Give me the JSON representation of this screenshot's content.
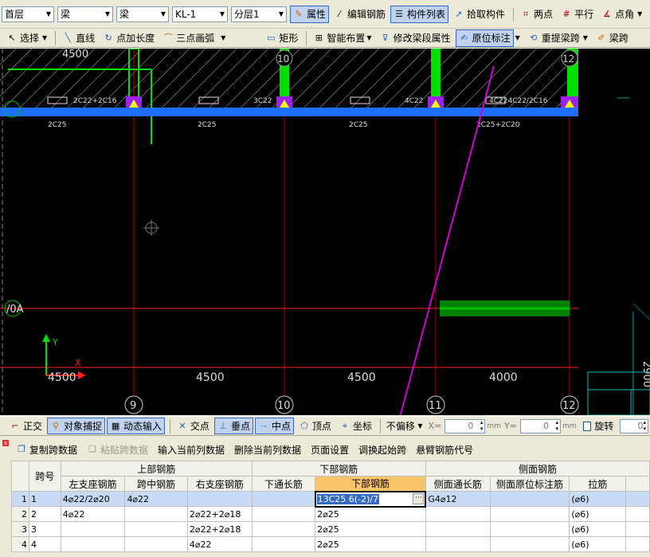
{
  "toolbar1": {
    "floor": "首层",
    "type1": "梁",
    "type2": "梁",
    "component": "KL-1",
    "layer": "分层1",
    "btn_property": "属性",
    "btn_edit_rebar": "编辑钢筋",
    "btn_component_list": "构件列表",
    "btn_pick": "拾取构件",
    "btn_two_points": "两点",
    "btn_parallel": "平行",
    "btn_point_angle": "点角"
  },
  "toolbar2": {
    "select": "选择",
    "line": "直线",
    "point_length": "点加长度",
    "three_point_arc": "三点画弧",
    "rect": "矩形",
    "smart_layout": "智能布置",
    "modify_span": "修改梁段属性",
    "in_place": "原位标注",
    "re_extract": "重提梁跨",
    "beam_span": "梁跨"
  },
  "canvas": {
    "top_dims": [
      "4500"
    ],
    "top_rebar": [
      "2C22+2C16",
      "3C22",
      "4C22",
      "4C224C22/2C16"
    ],
    "under_beam": [
      "2C25",
      "2C25",
      "2C25",
      "2C25+2C20"
    ],
    "axis_labels": [
      "9",
      "10",
      "11",
      "12"
    ],
    "axis_0A": "/0A",
    "bottom_dims": [
      "4500",
      "4500",
      "4500",
      "4000"
    ],
    "right_dim": "2900",
    "coord_y": "Y",
    "coord_x": "X"
  },
  "snapbar": {
    "ortho": "正交",
    "snap": "对象捕捉",
    "dynamic": "动态输入",
    "intersect": "交点",
    "perp": "垂点",
    "mid": "中点",
    "vertex": "顶点",
    "coord": "坐标",
    "offset": "不偏移",
    "x_label": "X=",
    "x_value": "0",
    "y_label": "Y=",
    "y_value": "0",
    "unit": "mm",
    "rotate": "旋转",
    "rotate_value": "0."
  },
  "tablebar": {
    "copy": "复制跨数据",
    "paste": "粘贴跨数据",
    "input_col": "输入当前列数据",
    "delete_col": "删除当前列数据",
    "page_setup": "页面设置",
    "swap_start": "调换起始跨",
    "cantilever": "悬臂钢筋代号"
  },
  "table": {
    "header_groups": {
      "span_no": "跨号",
      "top": "上部钢筋",
      "bottom": "下部钢筋",
      "side": "侧面钢筋"
    },
    "columns": [
      "左支座钢筋",
      "跨中钢筋",
      "右支座钢筋",
      "下通长筋",
      "下部钢筋",
      "侧面通长筋",
      "侧面原位标注筋",
      "拉筋"
    ],
    "rows": [
      {
        "n": "1",
        "span": "1",
        "cells": [
          "4⌀22/2⌀20",
          "4⌀22",
          "",
          "",
          "13C25 6(-2)/7",
          "G4⌀12",
          "",
          "(⌀6)"
        ]
      },
      {
        "n": "2",
        "span": "2",
        "cells": [
          "4⌀22",
          "",
          "2⌀22+2⌀18",
          "",
          "2⌀25",
          "",
          "",
          "(⌀6)"
        ]
      },
      {
        "n": "3",
        "span": "3",
        "cells": [
          "",
          "",
          "2⌀22+2⌀18",
          "",
          "2⌀25",
          "",
          "",
          "(⌀6)"
        ]
      },
      {
        "n": "4",
        "span": "4",
        "cells": [
          "",
          "",
          "4⌀22",
          "",
          "2⌀25",
          "",
          "",
          "(⌀6)"
        ]
      }
    ]
  },
  "colors": {
    "beam": "#1e6fff",
    "column": "#00e000",
    "grid_line": "#ff2020",
    "axis_line": "#b20000",
    "arrow": "#d000d0",
    "selection": "#316ac5"
  }
}
